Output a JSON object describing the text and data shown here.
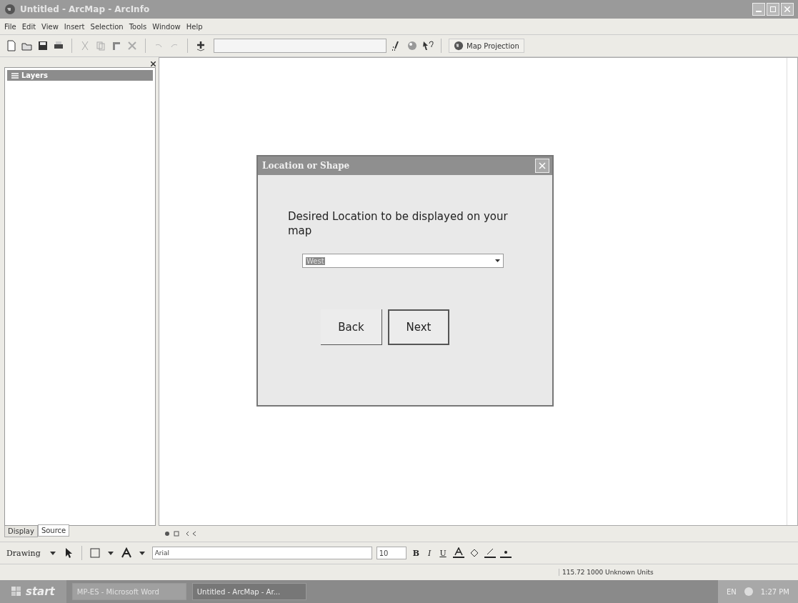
{
  "window": {
    "title": "Untitled - ArcMap - ArcInfo"
  },
  "menu": [
    "File",
    "Edit",
    "View",
    "Insert",
    "Selection",
    "Tools",
    "Window",
    "Help"
  ],
  "toolbar": {
    "map_projection": "Map Projection"
  },
  "toc": {
    "layers": "Layers",
    "tabs": [
      {
        "label": "Display",
        "selected": false
      },
      {
        "label": "Source",
        "selected": true
      }
    ]
  },
  "dialog": {
    "title": "Location or Shape",
    "prompt": "Desired Location to be displayed on your map",
    "dropdown": {
      "value": "West"
    },
    "buttons": [
      {
        "label": "Back",
        "default": false
      },
      {
        "label": "Next",
        "default": true
      }
    ]
  },
  "drawing_toolbar": {
    "label": "Drawing",
    "font": "Arial",
    "size": "10",
    "styles": [
      "B",
      "I",
      "U"
    ]
  },
  "status_bar": {
    "coordinates": "115.72 1000 Unknown Units"
  },
  "taskbar": {
    "start": "start",
    "tasks": [
      {
        "label": "MP-ES - Microsoft Word",
        "selected": false
      },
      {
        "label": "Untitled - ArcMap - Ar...",
        "selected": true
      }
    ],
    "language": "EN",
    "clock": "1:27 PM"
  }
}
